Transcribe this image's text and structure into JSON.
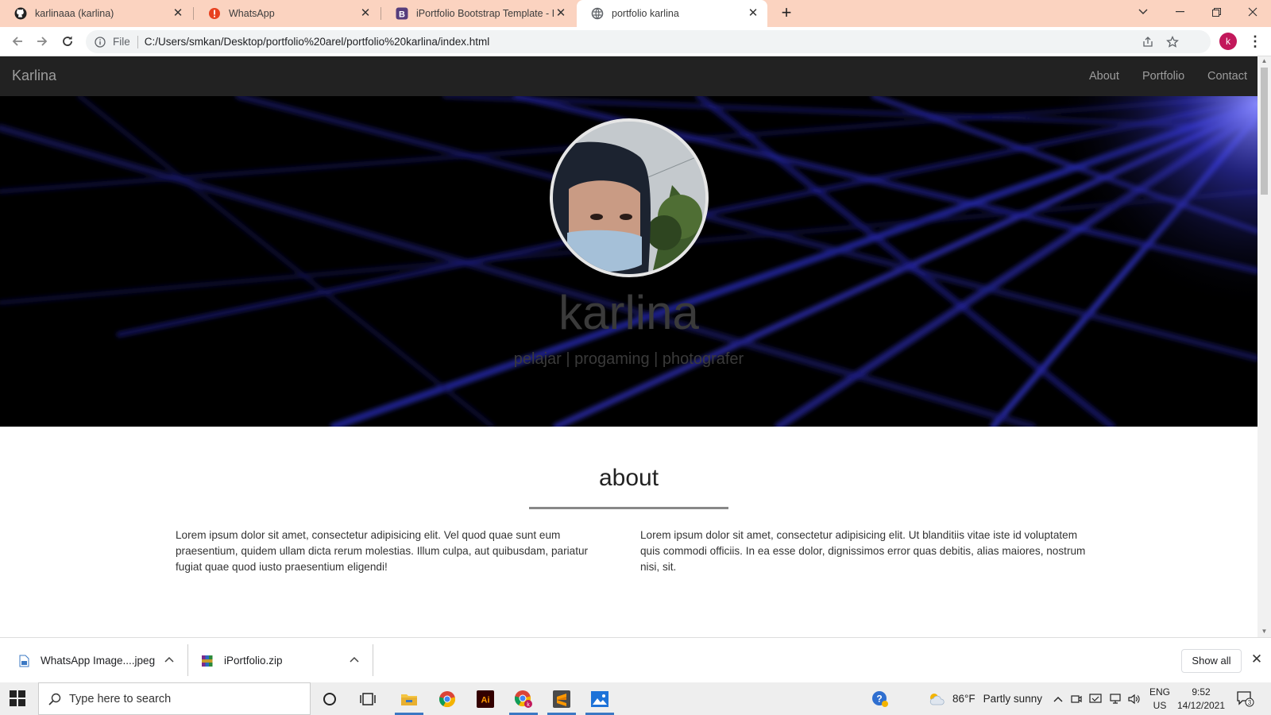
{
  "browser": {
    "tabs": [
      {
        "title": "karlinaaa (karlina)",
        "icon": "github-icon"
      },
      {
        "title": "WhatsApp",
        "icon": "whatsapp-alert-icon"
      },
      {
        "title": "iPortfolio Bootstrap Template - In",
        "icon": "bootstrap-icon"
      },
      {
        "title": "portfolio karlina",
        "icon": "globe-icon",
        "active": true
      }
    ],
    "address": {
      "scheme_label": "File",
      "url": "C:/Users/smkan/Desktop/portfolio%20arel/portfolio%20karlina/index.html"
    },
    "profile_initial": "k"
  },
  "site": {
    "nav": {
      "brand": "Karlina",
      "links": [
        "About",
        "Portfolio",
        "Contact"
      ]
    },
    "hero": {
      "name": "karlina",
      "subtitle": "pelajar | progaming | photografer"
    },
    "about": {
      "title": "about",
      "col1": "Lorem ipsum dolor sit amet, consectetur adipisicing elit. Vel quod quae sunt eum praesentium, quidem ullam dicta rerum molestias. Illum culpa, aut quibusdam, pariatur fugiat quae quod iusto praesentium eligendi!",
      "col2": "Lorem ipsum dolor sit amet, consectetur adipisicing elit. Ut blanditiis vitae iste id voluptatem quis commodi officiis. In ea esse dolor, dignissimos error quas debitis, alias maiores, nostrum nisi, sit."
    }
  },
  "downloads": {
    "items": [
      {
        "name": "WhatsApp Image....jpeg",
        "icon": "image-file-icon"
      },
      {
        "name": "iPortfolio.zip",
        "icon": "winrar-archive-icon"
      }
    ],
    "show_all": "Show all"
  },
  "taskbar": {
    "search_placeholder": "Type here to search",
    "weather": {
      "temp": "86°F",
      "condition": "Partly sunny"
    },
    "lang": {
      "line1": "ENG",
      "line2": "US"
    },
    "clock": {
      "time": "9:52",
      "date": "14/12/2021"
    },
    "notification_count": "3"
  }
}
